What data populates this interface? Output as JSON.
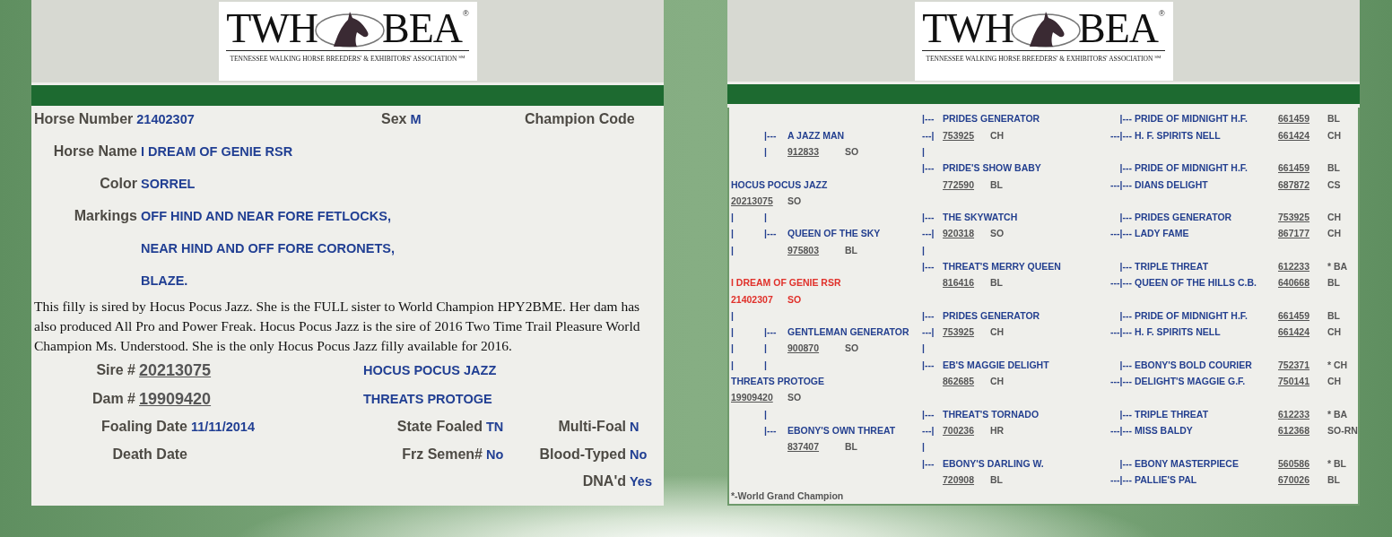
{
  "left_page": {
    "logo": {
      "left": "TWH",
      "right": "BEA",
      "registered": "®",
      "tagline": "TENNESSEE WALKING HORSE BREEDERS' & EXHIBITORS' ASSOCIATION",
      "service_mark": "SM"
    },
    "identity": [
      {
        "label": "Horse Number",
        "value": "21402307"
      },
      {
        "label": "Sex",
        "value": "M"
      },
      {
        "label": "Champion Code"
      }
    ],
    "fields": [
      {
        "label": "Horse Name",
        "values": [
          "I DREAM OF GENIE RSR"
        ]
      },
      {
        "label": "Color",
        "values": [
          "SORREL"
        ]
      },
      {
        "label": "Markings",
        "values": [
          "OFF HIND AND NEAR FORE FETLOCKS,",
          "NEAR HIND AND OFF FORE CORONETS,",
          "BLAZE."
        ]
      }
    ],
    "description": "This filly is sired by Hocus Pocus Jazz. She is the FULL sister to World Champion HPY2BME. Her dam has also produced All Pro and Power Freak. Hocus Pocus Jazz is the sire of 2016 Two Time Trail Pleasure World Champion Ms. Understood. She is the only Hocus Pocus Jazz filly available for 2016.",
    "parents": [
      {
        "label": "Sire #",
        "number": "20213075",
        "name": "HOCUS POCUS JAZZ"
      },
      {
        "label": "Dam #",
        "number": "19909420",
        "name": "THREATS PROTOGE"
      }
    ],
    "details": [
      {
        "column_1": {
          "label": "Foaling Date",
          "value": "11/11/2014"
        },
        "column_2": {
          "label": "State Foaled",
          "value": "TN"
        },
        "column_3": {
          "label": "Multi-Foal",
          "value": "N"
        }
      },
      {
        "column_1": {
          "label": "Death Date"
        },
        "column_2": {
          "label": "Frz Semen#",
          "value": "No"
        },
        "column_3": {
          "label": "Blood-Typed",
          "value": "No"
        }
      },
      {
        "column_3": {
          "label": "DNA'd",
          "value": "Yes"
        }
      }
    ]
  },
  "right_page": {
    "logo": {
      "left": "TWH",
      "right": "BEA",
      "registered": "®",
      "tagline": "TENNESSEE WALKING HORSE BREEDERS' & EXHIBITORS' ASSOCIATION",
      "service_mark": "SM"
    },
    "pedigree": [
      {
        "column_5": {
          "kind": "connector",
          "text": "|---"
        },
        "column_6": {
          "kind": "name",
          "text": "PRIDES GENERATOR"
        },
        "column_8": {
          "kind": "connector",
          "text": "|---"
        },
        "column_9": {
          "kind": "name",
          "text": "PRIDE OF MIDNIGHT H.F."
        },
        "column_10": {
          "kind": "reg",
          "text": "661459"
        },
        "column_11": {
          "kind": "code",
          "text": "BL"
        }
      },
      {
        "column_2": {
          "kind": "connector",
          "text": "|---"
        },
        "column_3": {
          "kind": "name",
          "text": "A JAZZ MAN"
        },
        "column_5": {
          "kind": "connector",
          "text": "---|"
        },
        "column_6": {
          "kind": "reg",
          "text": "753925"
        },
        "column_7": {
          "kind": "code",
          "text": "CH"
        },
        "column_8": {
          "kind": "connector",
          "text": "---|---"
        },
        "column_9": {
          "kind": "name",
          "text": "H. F. SPIRITS NELL"
        },
        "column_10": {
          "kind": "reg",
          "text": "661424"
        },
        "column_11": {
          "kind": "code",
          "text": "CH"
        }
      },
      {
        "column_2": {
          "kind": "connector",
          "text": "|"
        },
        "column_3": {
          "kind": "reg",
          "text": "912833"
        },
        "column_4": {
          "kind": "code",
          "text": "SO"
        },
        "column_5": {
          "kind": "connector",
          "text": "|"
        }
      },
      {
        "column_5": {
          "kind": "connector",
          "text": "|---"
        },
        "column_6": {
          "kind": "name",
          "text": "PRIDE'S SHOW BABY"
        },
        "column_8": {
          "kind": "connector",
          "text": "|---"
        },
        "column_9": {
          "kind": "name",
          "text": "PRIDE OF MIDNIGHT H.F."
        },
        "column_10": {
          "kind": "reg",
          "text": "661459"
        },
        "column_11": {
          "kind": "code",
          "text": "BL"
        }
      },
      {
        "column_1": {
          "kind": "name",
          "text": "HOCUS POCUS JAZZ"
        },
        "column_6": {
          "kind": "reg",
          "text": "772590"
        },
        "column_7": {
          "kind": "code",
          "text": "BL"
        },
        "column_8": {
          "kind": "connector",
          "text": "---|---"
        },
        "column_9": {
          "kind": "name",
          "text": "DIANS DELIGHT"
        },
        "column_10": {
          "kind": "reg",
          "text": "687872"
        },
        "column_11": {
          "kind": "code",
          "text": "CS"
        }
      },
      {
        "column_1": {
          "kind": "reg",
          "text": "20213075"
        },
        "column_3": {
          "kind": "code",
          "text": "SO"
        }
      },
      {
        "column_1": {
          "kind": "connector",
          "text": "|"
        },
        "column_2": {
          "kind": "connector",
          "text": "|"
        },
        "column_5": {
          "kind": "connector",
          "text": "|---"
        },
        "column_6": {
          "kind": "name",
          "text": "THE SKYWATCH"
        },
        "column_8": {
          "kind": "connector",
          "text": "|---"
        },
        "column_9": {
          "kind": "name",
          "text": "PRIDES GENERATOR"
        },
        "column_10": {
          "kind": "reg",
          "text": "753925"
        },
        "column_11": {
          "kind": "code",
          "text": "CH"
        }
      },
      {
        "column_1": {
          "kind": "connector",
          "text": "|"
        },
        "column_2": {
          "kind": "connector",
          "text": "|---"
        },
        "column_3": {
          "kind": "name",
          "text": "QUEEN OF THE SKY"
        },
        "column_5": {
          "kind": "connector",
          "text": "---|"
        },
        "column_6": {
          "kind": "reg",
          "text": "920318"
        },
        "column_7": {
          "kind": "code",
          "text": "SO"
        },
        "column_8": {
          "kind": "connector",
          "text": "---|---"
        },
        "column_9": {
          "kind": "name",
          "text": "LADY FAME"
        },
        "column_10": {
          "kind": "reg",
          "text": "867177"
        },
        "column_11": {
          "kind": "code",
          "text": "CH"
        }
      },
      {
        "column_1": {
          "kind": "connector",
          "text": "|"
        },
        "column_3": {
          "kind": "reg",
          "text": "975803"
        },
        "column_4": {
          "kind": "code",
          "text": "BL"
        },
        "column_5": {
          "kind": "connector",
          "text": "|"
        }
      },
      {
        "column_5": {
          "kind": "connector",
          "text": "|---"
        },
        "column_6": {
          "kind": "name",
          "text": "THREAT'S MERRY QUEEN"
        },
        "column_8": {
          "kind": "connector",
          "text": "|---"
        },
        "column_9": {
          "kind": "name",
          "text": "TRIPLE THREAT"
        },
        "column_10": {
          "kind": "reg",
          "text": "612233"
        },
        "column_11": {
          "kind": "code",
          "text": "* BA"
        }
      },
      {
        "column_1": {
          "kind": "subject_name",
          "text": "I DREAM OF GENIE RSR"
        },
        "column_6": {
          "kind": "reg",
          "text": "816416"
        },
        "column_7": {
          "kind": "code",
          "text": "BL"
        },
        "column_8": {
          "kind": "connector",
          "text": "---|---"
        },
        "column_9": {
          "kind": "name",
          "text": "QUEEN OF THE HILLS C.B."
        },
        "column_10": {
          "kind": "reg",
          "text": "640668"
        },
        "column_11": {
          "kind": "code",
          "text": "BL"
        }
      },
      {
        "column_1": {
          "kind": "subject_reg",
          "text": "21402307"
        },
        "column_3": {
          "kind": "subject_code",
          "text": "SO"
        }
      },
      {
        "column_1": {
          "kind": "connector",
          "text": "|"
        },
        "column_5": {
          "kind": "connector",
          "text": "|---"
        },
        "column_6": {
          "kind": "name",
          "text": "PRIDES GENERATOR"
        },
        "column_8": {
          "kind": "connector",
          "text": "|---"
        },
        "column_9": {
          "kind": "name",
          "text": "PRIDE OF MIDNIGHT H.F."
        },
        "column_10": {
          "kind": "reg",
          "text": "661459"
        },
        "column_11": {
          "kind": "code",
          "text": "BL"
        }
      },
      {
        "column_1": {
          "kind": "connector",
          "text": "|"
        },
        "column_2": {
          "kind": "connector",
          "text": "|---"
        },
        "column_3": {
          "kind": "name",
          "text": "GENTLEMAN GENERATOR"
        },
        "column_5": {
          "kind": "connector",
          "text": "---|"
        },
        "column_6": {
          "kind": "reg",
          "text": "753925"
        },
        "column_7": {
          "kind": "code",
          "text": "CH"
        },
        "column_8": {
          "kind": "connector",
          "text": "---|---"
        },
        "column_9": {
          "kind": "name",
          "text": "H. F. SPIRITS NELL"
        },
        "column_10": {
          "kind": "reg",
          "text": "661424"
        },
        "column_11": {
          "kind": "code",
          "text": "CH"
        }
      },
      {
        "column_1": {
          "kind": "connector",
          "text": "|"
        },
        "column_2": {
          "kind": "connector",
          "text": "|"
        },
        "column_3": {
          "kind": "reg",
          "text": "900870"
        },
        "column_4": {
          "kind": "code",
          "text": "SO"
        },
        "column_5": {
          "kind": "connector",
          "text": "|"
        }
      },
      {
        "column_1": {
          "kind": "connector",
          "text": "|"
        },
        "column_2": {
          "kind": "connector",
          "text": "|"
        },
        "column_5": {
          "kind": "connector",
          "text": "|---"
        },
        "column_6": {
          "kind": "name",
          "text": "EB'S MAGGIE DELIGHT"
        },
        "column_8": {
          "kind": "connector",
          "text": "|---"
        },
        "column_9": {
          "kind": "name",
          "text": "EBONY'S BOLD COURIER"
        },
        "column_10": {
          "kind": "reg",
          "text": "752371"
        },
        "column_11": {
          "kind": "code",
          "text": "* CH"
        }
      },
      {
        "column_1": {
          "kind": "name",
          "text": "THREATS PROTOGE"
        },
        "column_6": {
          "kind": "reg",
          "text": "862685"
        },
        "column_7": {
          "kind": "code",
          "text": "CH"
        },
        "column_8": {
          "kind": "connector",
          "text": "---|---"
        },
        "column_9": {
          "kind": "name",
          "text": "DELIGHT'S MAGGIE G.F."
        },
        "column_10": {
          "kind": "reg",
          "text": "750141"
        },
        "column_11": {
          "kind": "code",
          "text": "CH"
        }
      },
      {
        "column_1": {
          "kind": "reg",
          "text": "19909420"
        },
        "column_3": {
          "kind": "code",
          "text": "SO"
        }
      },
      {
        "column_2": {
          "kind": "connector",
          "text": "|"
        },
        "column_5": {
          "kind": "connector",
          "text": "|---"
        },
        "column_6": {
          "kind": "name",
          "text": "THREAT'S TORNADO"
        },
        "column_8": {
          "kind": "connector",
          "text": "|---"
        },
        "column_9": {
          "kind": "name",
          "text": "TRIPLE THREAT"
        },
        "column_10": {
          "kind": "reg",
          "text": "612233"
        },
        "column_11": {
          "kind": "code",
          "text": "* BA"
        }
      },
      {
        "column_2": {
          "kind": "connector",
          "text": "|---"
        },
        "column_3": {
          "kind": "name",
          "text": "EBONY'S OWN THREAT"
        },
        "column_5": {
          "kind": "connector",
          "text": "---|"
        },
        "column_6": {
          "kind": "reg",
          "text": "700236"
        },
        "column_7": {
          "kind": "code",
          "text": "HR"
        },
        "column_8": {
          "kind": "connector",
          "text": "---|---"
        },
        "column_9": {
          "kind": "name",
          "text": "MISS BALDY"
        },
        "column_10": {
          "kind": "reg",
          "text": "612368"
        },
        "column_11": {
          "kind": "code",
          "text": "SO-RN"
        }
      },
      {
        "column_3": {
          "kind": "reg",
          "text": "837407"
        },
        "column_4": {
          "kind": "code",
          "text": "BL"
        },
        "column_5": {
          "kind": "connector",
          "text": "|"
        }
      },
      {
        "column_5": {
          "kind": "connector",
          "text": "|---"
        },
        "column_6": {
          "kind": "name",
          "text": "EBONY'S DARLING W."
        },
        "column_8": {
          "kind": "connector",
          "text": "|---"
        },
        "column_9": {
          "kind": "name",
          "text": "EBONY MASTERPIECE"
        },
        "column_10": {
          "kind": "reg",
          "text": "560586"
        },
        "column_11": {
          "kind": "code",
          "text": "* BL"
        }
      },
      {
        "column_6": {
          "kind": "reg",
          "text": "720908"
        },
        "column_7": {
          "kind": "code",
          "text": "BL"
        },
        "column_8": {
          "kind": "connector",
          "text": "---|---"
        },
        "column_9": {
          "kind": "name",
          "text": "PALLIE'S PAL"
        },
        "column_10": {
          "kind": "reg",
          "text": "670026"
        },
        "column_11": {
          "kind": "code",
          "text": "BL"
        }
      }
    ],
    "footnote": "*-World Grand Champion"
  }
}
